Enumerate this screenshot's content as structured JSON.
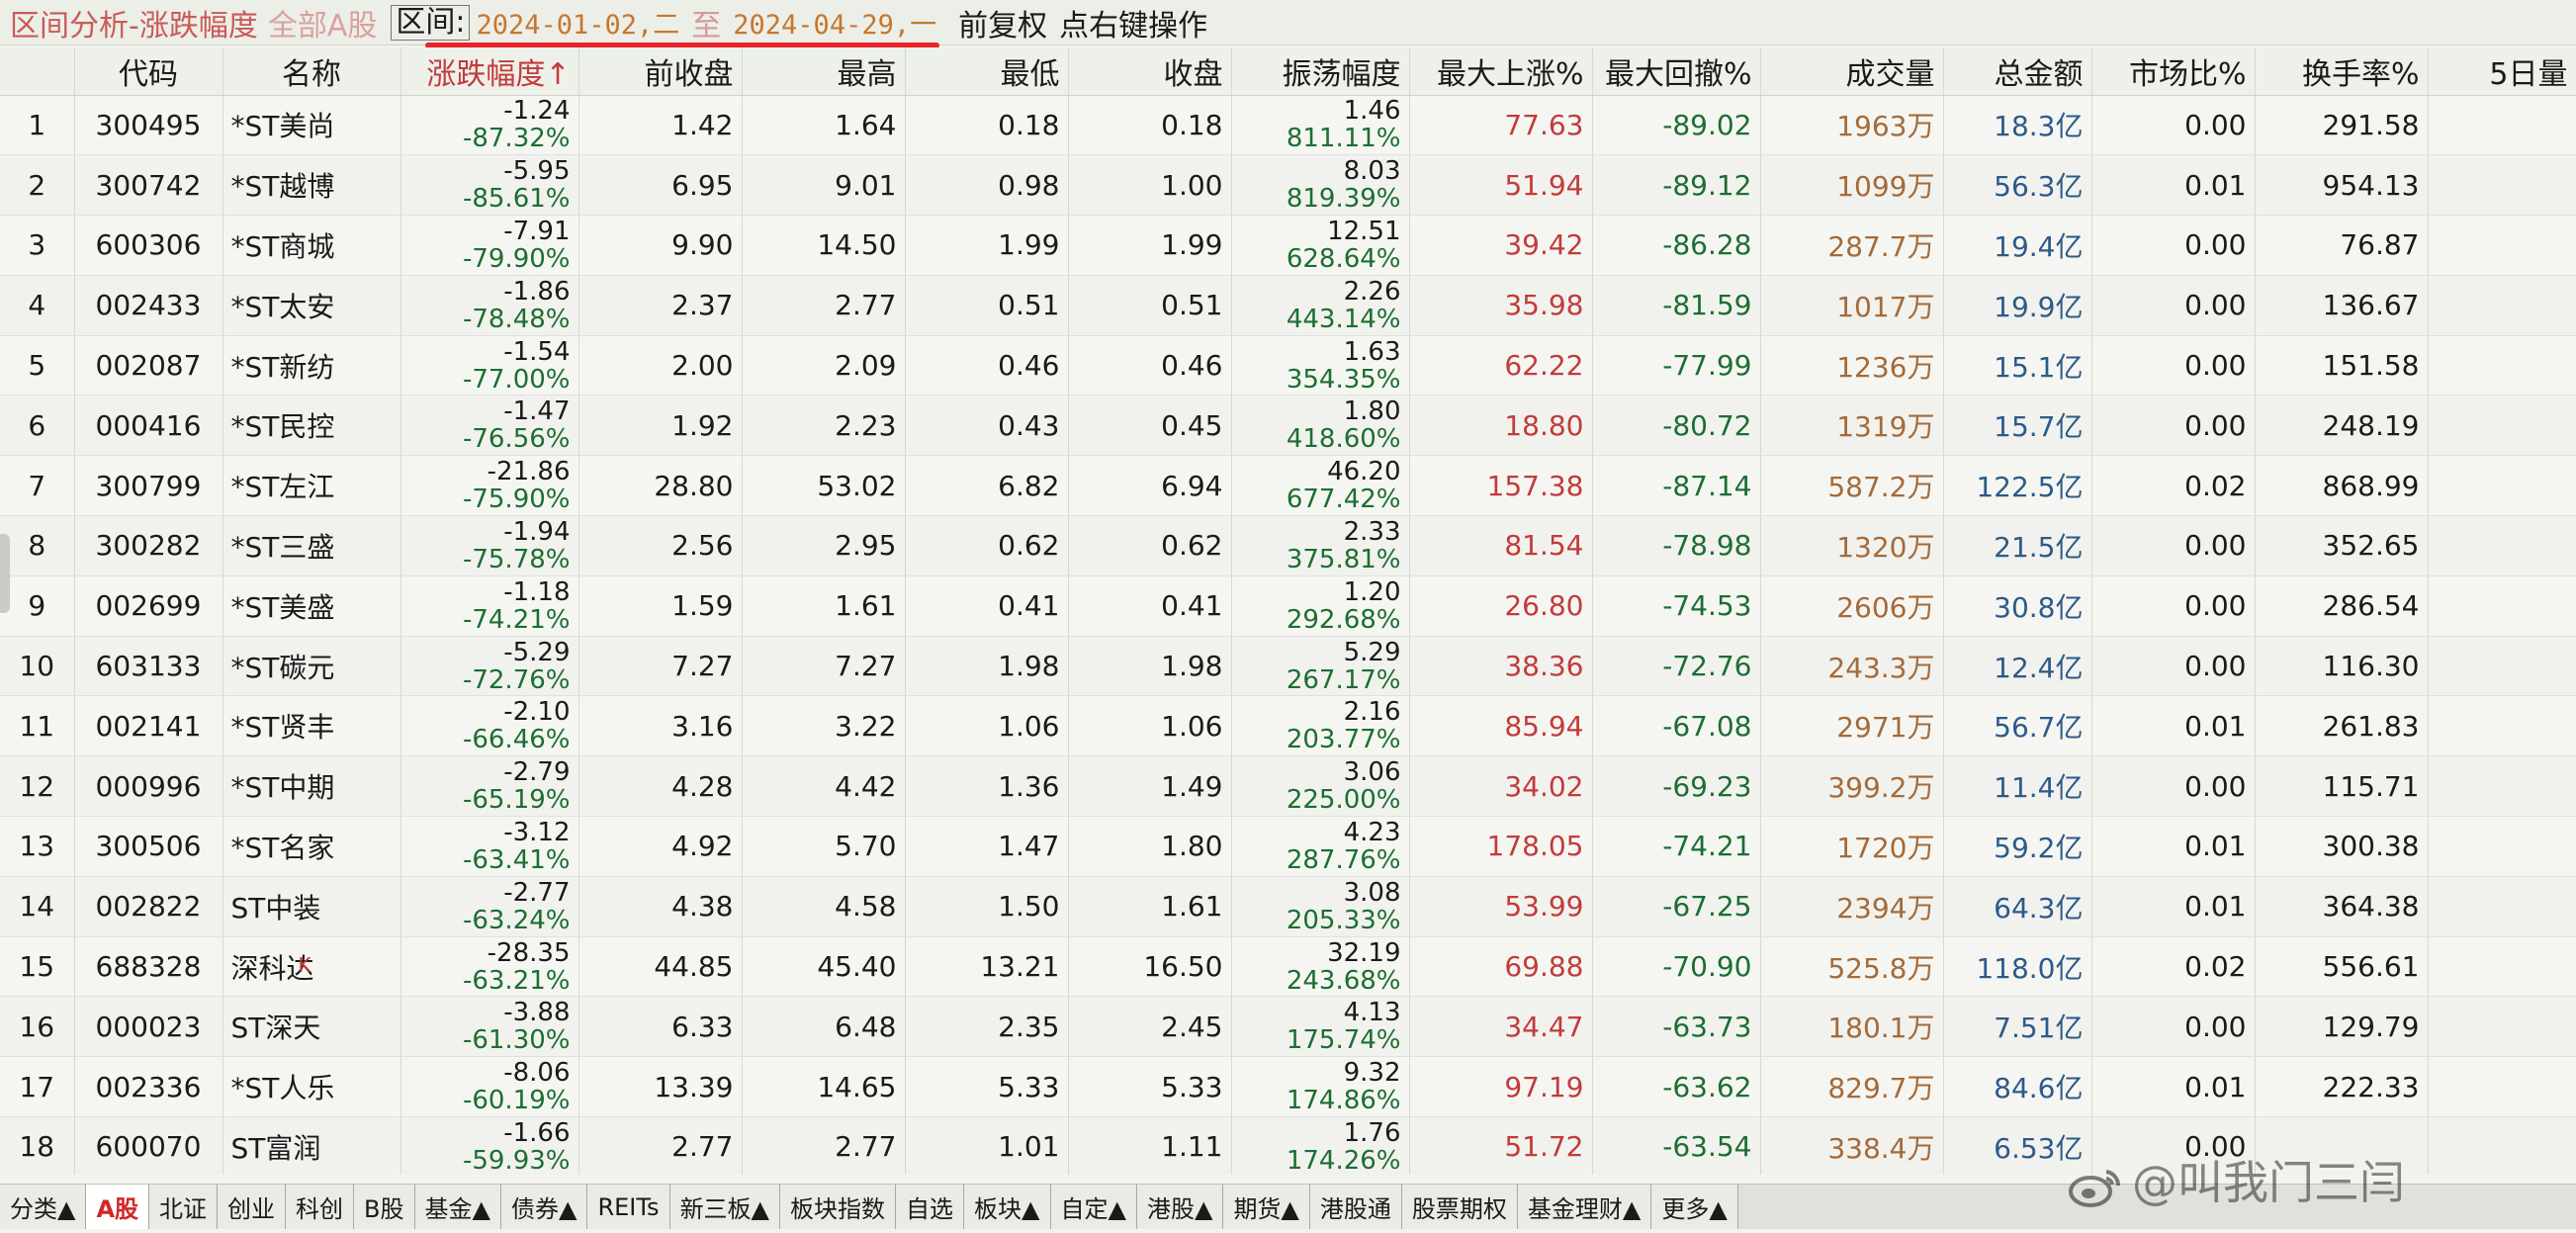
{
  "title": {
    "app": "区间分析-涨跌幅度",
    "market": "全部A股",
    "range_label": "区间:",
    "start": "2024-01-02,二",
    "to": "至",
    "end": "2024-04-29,一",
    "adjust": "前复权",
    "ops": "点右键操作"
  },
  "colors": {
    "up": "#c23b3b",
    "down": "#1c6e32",
    "accent_line": "#e8242b"
  },
  "columns": [
    "代码",
    "名称",
    "涨跌幅度↑",
    "前收盘",
    "最高",
    "最低",
    "收盘",
    "振荡幅度",
    "最大上涨%",
    "最大回撤%",
    "成交量",
    "总金额",
    "市场比%",
    "换手率%",
    "5日量"
  ],
  "rows": [
    {
      "idx": "1",
      "code": "300495",
      "name": "*ST美尚",
      "chg": "-1.24",
      "pct": "-87.32%",
      "prev": "1.42",
      "high": "1.64",
      "low": "0.18",
      "close": "0.18",
      "osc": "1.46",
      "oscp": "811.11%",
      "maxup": "77.63",
      "maxdd": "-89.02",
      "vol": "1963万",
      "amt": "18.3亿",
      "mkt": "0.00",
      "turn": "291.58"
    },
    {
      "idx": "2",
      "code": "300742",
      "name": "*ST越博",
      "chg": "-5.95",
      "pct": "-85.61%",
      "prev": "6.95",
      "high": "9.01",
      "low": "0.98",
      "close": "1.00",
      "osc": "8.03",
      "oscp": "819.39%",
      "maxup": "51.94",
      "maxdd": "-89.12",
      "vol": "1099万",
      "amt": "56.3亿",
      "mkt": "0.01",
      "turn": "954.13"
    },
    {
      "idx": "3",
      "code": "600306",
      "name": "*ST商城",
      "chg": "-7.91",
      "pct": "-79.90%",
      "prev": "9.90",
      "high": "14.50",
      "low": "1.99",
      "close": "1.99",
      "osc": "12.51",
      "oscp": "628.64%",
      "maxup": "39.42",
      "maxdd": "-86.28",
      "vol": "287.7万",
      "amt": "19.4亿",
      "mkt": "0.00",
      "turn": "76.87"
    },
    {
      "idx": "4",
      "code": "002433",
      "name": "*ST太安",
      "chg": "-1.86",
      "pct": "-78.48%",
      "prev": "2.37",
      "high": "2.77",
      "low": "0.51",
      "close": "0.51",
      "osc": "2.26",
      "oscp": "443.14%",
      "maxup": "35.98",
      "maxdd": "-81.59",
      "vol": "1017万",
      "amt": "19.9亿",
      "mkt": "0.00",
      "turn": "136.67"
    },
    {
      "idx": "5",
      "code": "002087",
      "name": "*ST新纺",
      "chg": "-1.54",
      "pct": "-77.00%",
      "prev": "2.00",
      "high": "2.09",
      "low": "0.46",
      "close": "0.46",
      "osc": "1.63",
      "oscp": "354.35%",
      "maxup": "62.22",
      "maxdd": "-77.99",
      "vol": "1236万",
      "amt": "15.1亿",
      "mkt": "0.00",
      "turn": "151.58"
    },
    {
      "idx": "6",
      "code": "000416",
      "name": "*ST民控",
      "chg": "-1.47",
      "pct": "-76.56%",
      "prev": "1.92",
      "high": "2.23",
      "low": "0.43",
      "close": "0.45",
      "osc": "1.80",
      "oscp": "418.60%",
      "maxup": "18.80",
      "maxdd": "-80.72",
      "vol": "1319万",
      "amt": "15.7亿",
      "mkt": "0.00",
      "turn": "248.19"
    },
    {
      "idx": "7",
      "code": "300799",
      "name": "*ST左江",
      "chg": "-21.86",
      "pct": "-75.90%",
      "prev": "28.80",
      "high": "53.02",
      "low": "6.82",
      "close": "6.94",
      "osc": "46.20",
      "oscp": "677.42%",
      "maxup": "157.38",
      "maxdd": "-87.14",
      "vol": "587.2万",
      "amt": "122.5亿",
      "mkt": "0.02",
      "turn": "868.99"
    },
    {
      "idx": "8",
      "code": "300282",
      "name": "*ST三盛",
      "chg": "-1.94",
      "pct": "-75.78%",
      "prev": "2.56",
      "high": "2.95",
      "low": "0.62",
      "close": "0.62",
      "osc": "2.33",
      "oscp": "375.81%",
      "maxup": "81.54",
      "maxdd": "-78.98",
      "vol": "1320万",
      "amt": "21.5亿",
      "mkt": "0.00",
      "turn": "352.65"
    },
    {
      "idx": "9",
      "code": "002699",
      "name": "*ST美盛",
      "chg": "-1.18",
      "pct": "-74.21%",
      "prev": "1.59",
      "high": "1.61",
      "low": "0.41",
      "close": "0.41",
      "osc": "1.20",
      "oscp": "292.68%",
      "maxup": "26.80",
      "maxdd": "-74.53",
      "vol": "2606万",
      "amt": "30.8亿",
      "mkt": "0.00",
      "turn": "286.54"
    },
    {
      "idx": "10",
      "code": "603133",
      "name": "*ST碳元",
      "chg": "-5.29",
      "pct": "-72.76%",
      "prev": "7.27",
      "high": "7.27",
      "low": "1.98",
      "close": "1.98",
      "osc": "5.29",
      "oscp": "267.17%",
      "maxup": "38.36",
      "maxdd": "-72.76",
      "vol": "243.3万",
      "amt": "12.4亿",
      "mkt": "0.00",
      "turn": "116.30"
    },
    {
      "idx": "11",
      "code": "002141",
      "name": "*ST贤丰",
      "chg": "-2.10",
      "pct": "-66.46%",
      "prev": "3.16",
      "high": "3.22",
      "low": "1.06",
      "close": "1.06",
      "osc": "2.16",
      "oscp": "203.77%",
      "maxup": "85.94",
      "maxdd": "-67.08",
      "vol": "2971万",
      "amt": "56.7亿",
      "mkt": "0.01",
      "turn": "261.83"
    },
    {
      "idx": "12",
      "code": "000996",
      "name": "*ST中期",
      "chg": "-2.79",
      "pct": "-65.19%",
      "prev": "4.28",
      "high": "4.42",
      "low": "1.36",
      "close": "1.49",
      "osc": "3.06",
      "oscp": "225.00%",
      "maxup": "34.02",
      "maxdd": "-69.23",
      "vol": "399.2万",
      "amt": "11.4亿",
      "mkt": "0.00",
      "turn": "115.71"
    },
    {
      "idx": "13",
      "code": "300506",
      "name": "*ST名家",
      "chg": "-3.12",
      "pct": "-63.41%",
      "prev": "4.92",
      "high": "5.70",
      "low": "1.47",
      "close": "1.80",
      "osc": "4.23",
      "oscp": "287.76%",
      "maxup": "178.05",
      "maxdd": "-74.21",
      "vol": "1720万",
      "amt": "59.2亿",
      "mkt": "0.01",
      "turn": "300.38"
    },
    {
      "idx": "14",
      "code": "002822",
      "name": "ST中装",
      "chg": "-2.77",
      "pct": "-63.24%",
      "prev": "4.38",
      "high": "4.58",
      "low": "1.50",
      "close": "1.61",
      "osc": "3.08",
      "oscp": "205.33%",
      "maxup": "53.99",
      "maxdd": "-67.25",
      "vol": "2394万",
      "amt": "64.3亿",
      "mkt": "0.01",
      "turn": "364.38"
    },
    {
      "idx": "15",
      "code": "688328",
      "name": "深科达",
      "flag": "K",
      "chg": "-28.35",
      "pct": "-63.21%",
      "prev": "44.85",
      "high": "45.40",
      "low": "13.21",
      "close": "16.50",
      "osc": "32.19",
      "oscp": "243.68%",
      "maxup": "69.88",
      "maxdd": "-70.90",
      "vol": "525.8万",
      "amt": "118.0亿",
      "mkt": "0.02",
      "turn": "556.61"
    },
    {
      "idx": "16",
      "code": "000023",
      "name": "ST深天",
      "chg": "-3.88",
      "pct": "-61.30%",
      "prev": "6.33",
      "high": "6.48",
      "low": "2.35",
      "close": "2.45",
      "osc": "4.13",
      "oscp": "175.74%",
      "maxup": "34.47",
      "maxdd": "-63.73",
      "vol": "180.1万",
      "amt": "7.51亿",
      "mkt": "0.00",
      "turn": "129.79"
    },
    {
      "idx": "17",
      "code": "002336",
      "name": "*ST人乐",
      "chg": "-8.06",
      "pct": "-60.19%",
      "prev": "13.39",
      "high": "14.65",
      "low": "5.33",
      "close": "5.33",
      "osc": "9.32",
      "oscp": "174.86%",
      "maxup": "97.19",
      "maxdd": "-63.62",
      "vol": "829.7万",
      "amt": "84.6亿",
      "mkt": "0.01",
      "turn": "222.33"
    },
    {
      "idx": "18",
      "code": "600070",
      "name": "ST富润",
      "chg": "-1.66",
      "pct": "-59.93%",
      "prev": "2.77",
      "high": "2.77",
      "low": "1.01",
      "close": "1.11",
      "osc": "1.76",
      "oscp": "174.26%",
      "maxup": "51.72",
      "maxdd": "-63.54",
      "vol": "338.4万",
      "amt": "6.53亿",
      "mkt": "0.00",
      "turn": ""
    }
  ],
  "tabs": [
    "分类▲",
    "A股",
    "北证",
    "创业",
    "科创",
    "B股",
    "基金▲",
    "债券▲",
    "REITs",
    "新三板▲",
    "板块指数",
    "自选",
    "板块▲",
    "自定▲",
    "港股▲",
    "期货▲",
    "港股通",
    "股票期权",
    "基金理财▲",
    "更多▲"
  ],
  "active_tab": "A股",
  "watermark": "@叫我门三闫"
}
